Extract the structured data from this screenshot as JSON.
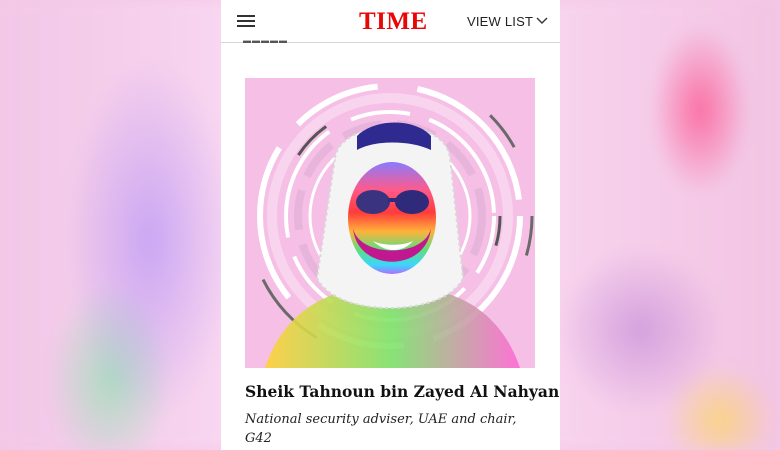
{
  "header": {
    "logo": "TIME",
    "view_list_label": "VIEW LIST"
  },
  "icons": {
    "menu": "hamburger-menu-icon",
    "dropdown": "chevron-down-icon"
  },
  "colors": {
    "brand_red": "#e90606",
    "photo_background": "#f6bfe6"
  },
  "entry": {
    "name": "Sheik Tahnoun bin Zayed Al Nahyan",
    "role": "National security adviser, UAE and chair, G42"
  }
}
